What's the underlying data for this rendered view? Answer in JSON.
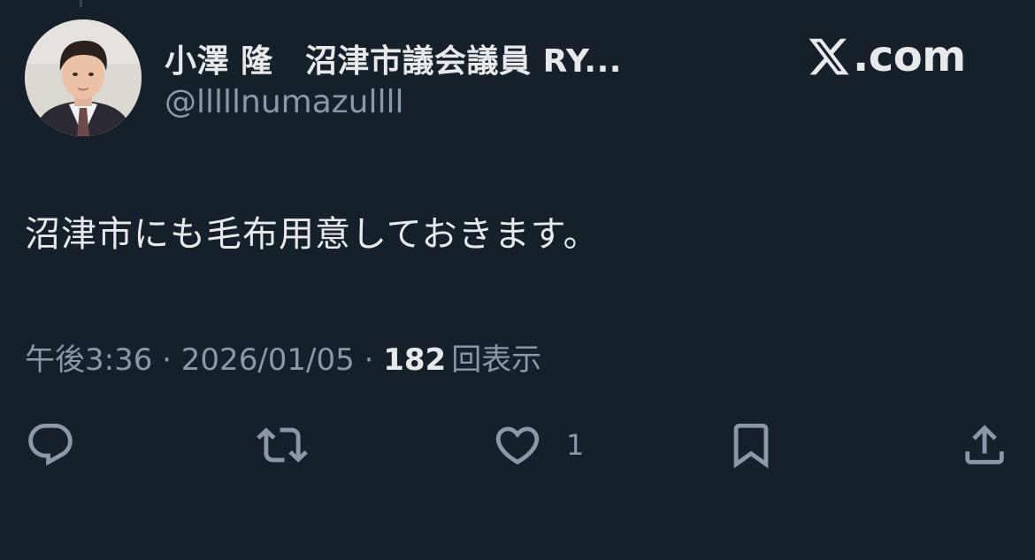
{
  "author": {
    "display_name": "小澤 隆　沼津市議会議員 RY...",
    "handle": "@lllllnumazullll"
  },
  "brand": {
    "label": ".com"
  },
  "tweet": {
    "text": "沼津市にも毛布用意しておきます。"
  },
  "meta": {
    "time": "午後3:36",
    "sep1": " · ",
    "date": "2026/01/05",
    "sep2": " · ",
    "views_count": "182",
    "views_label": "回表示"
  },
  "actions": {
    "like_count": "1"
  },
  "icons": {
    "reply": "reply-icon",
    "retweet": "retweet-icon",
    "like": "heart-icon",
    "bookmark": "bookmark-icon",
    "share": "share-icon"
  },
  "colors": {
    "background": "#15202b",
    "primary_text": "#e7e9ea",
    "secondary_text": "#8b98a5"
  }
}
